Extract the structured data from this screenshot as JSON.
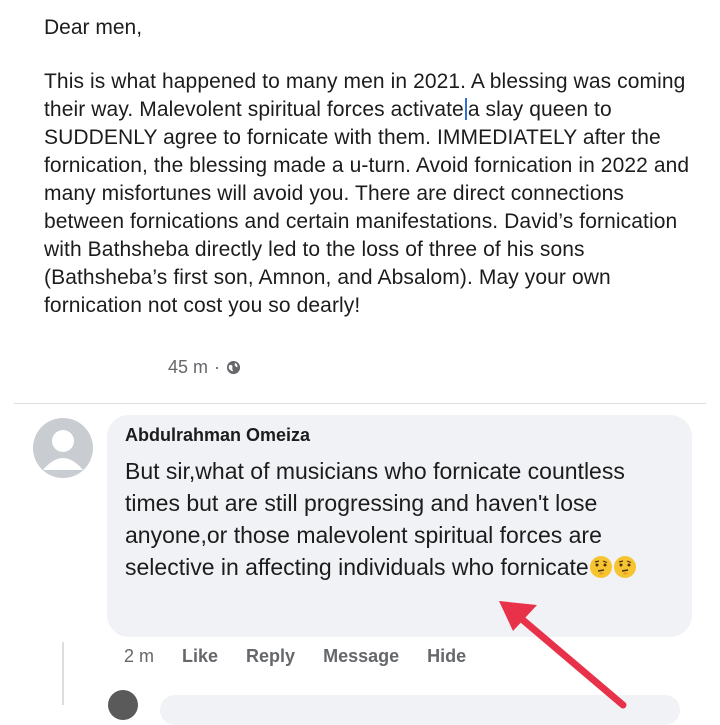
{
  "post": {
    "salutation": "Dear men,",
    "body_before_cursor": "This is what happened to many men in 2021. A blessing was coming their way. Malevolent spiritual forces activate",
    "body_after_cursor": "a slay queen to SUDDENLY agree to fornicate with them. IMMEDIATELY after the fornication, the blessing made a u-turn. Avoid fornication in 2022 and many misfortunes will avoid you. There are direct connections between fornications and certain manifestations. David’s fornication with Bathsheba directly led to the loss of three of his sons (Bathsheba’s first son, Amnon, and Absalom). May your own fornication not cost you so dearly!",
    "time": "45 m",
    "separator": "·",
    "privacy_icon": "globe-icon"
  },
  "comment": {
    "author": "Abdulrahman Omeiza",
    "text": "But sir,what of musicians who fornicate countless times but are still progressing and haven't lose anyone,or those malevolent spiritual forces are selective in affecting individuals who fornicate",
    "emojis": [
      "thinking-face",
      "thinking-face"
    ],
    "time": "2 m",
    "actions": [
      "Like",
      "Reply",
      "Message",
      "Hide"
    ]
  },
  "colors": {
    "bubble": "#f0f2f5",
    "meta_text": "#65676b",
    "arrow": "#e8324a",
    "cursor": "#2f6fd6"
  }
}
